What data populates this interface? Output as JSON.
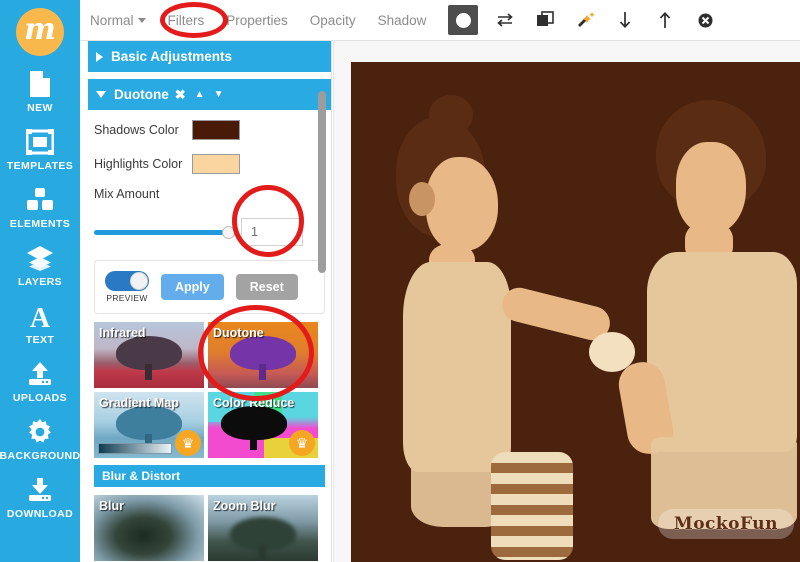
{
  "app": {
    "logo_letter": "m"
  },
  "sidebar": {
    "items": [
      {
        "label": "NEW",
        "icon": "document-icon"
      },
      {
        "label": "TEMPLATES",
        "icon": "templates-icon"
      },
      {
        "label": "ELEMENTS",
        "icon": "elements-icon"
      },
      {
        "label": "LAYERS",
        "icon": "layers-icon"
      },
      {
        "label": "TEXT",
        "icon": "text-icon"
      },
      {
        "label": "UPLOADS",
        "icon": "upload-icon"
      },
      {
        "label": "BACKGROUND",
        "icon": "gear-icon"
      },
      {
        "label": "DOWNLOAD",
        "icon": "download-icon"
      }
    ]
  },
  "toolbar": {
    "blend_mode": "Normal",
    "filters": "Filters",
    "properties": "Properties",
    "opacity": "Opacity",
    "shadow": "Shadow",
    "icons": [
      "mask-icon",
      "flip-icon",
      "duplicate-icon",
      "magic-wand-icon",
      "move-down-icon",
      "move-up-icon",
      "delete-icon"
    ]
  },
  "panel": {
    "sections": [
      {
        "title": "Basic Adjustments",
        "expanded": false
      },
      {
        "title": "Duotone",
        "expanded": true,
        "close_glyph": "✖"
      }
    ],
    "fields": [
      {
        "label": "Shadows Color",
        "color": "#4a1a08"
      },
      {
        "label": "Highlights Color",
        "color": "#fad5a0"
      }
    ],
    "mix_amount": {
      "label": "Mix Amount",
      "value": "1",
      "fill_percent": 100
    },
    "actions": {
      "preview_label": "PREVIEW",
      "preview_on": true,
      "apply_label": "Apply",
      "reset_label": "Reset"
    },
    "filter_thumbs": [
      {
        "name": "Infrared",
        "premium": false
      },
      {
        "name": "Duotone",
        "premium": false
      },
      {
        "name": "Gradient Map",
        "premium": true
      },
      {
        "name": "Color Reduce",
        "premium": true
      }
    ],
    "blur_section": {
      "title": "Blur & Distort"
    },
    "blur_thumbs": [
      {
        "name": "Blur",
        "premium": false
      },
      {
        "name": "Zoom Blur",
        "premium": false
      }
    ],
    "premium_glyph": "♛"
  },
  "canvas": {
    "watermark": "MockoFun"
  },
  "annotations": [
    {
      "target": "filters-tab"
    },
    {
      "target": "mix-amount-value"
    },
    {
      "target": "duotone-thumbnail"
    }
  ],
  "colors": {
    "brand_blue": "#28aae1",
    "logo_orange": "#f9b84c",
    "accent_red": "#e31b1b",
    "apply_blue": "#63adec",
    "reset_gray": "#a3a3a3"
  }
}
